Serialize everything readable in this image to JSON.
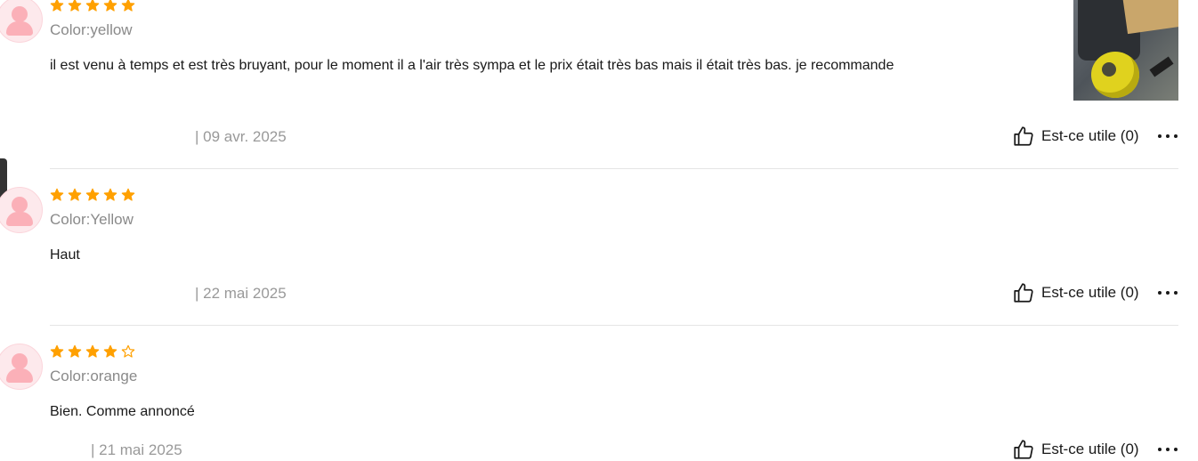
{
  "colors": {
    "star": "#ffa000",
    "accent_avatar": "#fbb0b8",
    "divider": "#e5e5e5"
  },
  "icons": {
    "avatar": "user-avatar-icon",
    "star_filled": "star-filled-icon",
    "star_empty": "star-outline-icon",
    "thumb_up": "thumbs-up-icon",
    "more": "more-dots-icon"
  },
  "reviews": [
    {
      "rating": 5,
      "color": "Color:yellow",
      "text": "il est venu à temps et est très bruyant, pour le moment il a l'air très sympa et le prix était très bas mais il était très bas. je recommande",
      "date": "| 09 avr. 2025",
      "useful": "Est-ce utile (0)",
      "has_photo": true
    },
    {
      "rating": 5,
      "color": "Color:Yellow",
      "text": "Haut",
      "date": "| 22 mai 2025",
      "useful": "Est-ce utile (0)",
      "has_photo": false
    },
    {
      "rating": 4,
      "color": "Color:orange",
      "text": "Bien. Comme annoncé",
      "date": "| 21 mai 2025",
      "useful": "Est-ce utile (0)",
      "has_photo": false
    }
  ]
}
